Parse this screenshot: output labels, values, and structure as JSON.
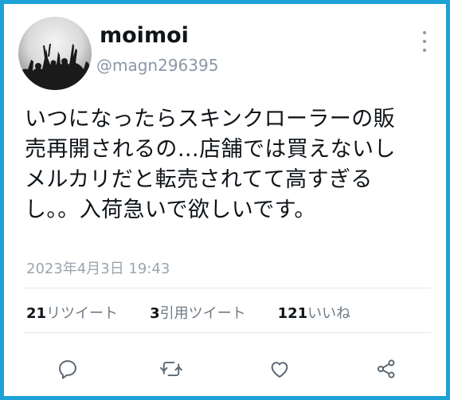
{
  "user": {
    "display_name": "moimoi",
    "handle": "@magn296395"
  },
  "tweet": {
    "text": "いつになったらスキンクローラーの販\n売再開されるの…店舗では買えないし\nメルカリだと転売されてて高すぎる\nし。。入荷急いで欲しいです。",
    "timestamp": "2023年4月3日 19:43"
  },
  "stats": {
    "retweets_count": "21",
    "retweets_label": "リツイート",
    "quotes_count": "3",
    "quotes_label": "引用ツイート",
    "likes_count": "121",
    "likes_label": "いいね"
  },
  "icons": {
    "more": "more-vertical-icon",
    "reply": "reply-icon",
    "retweet": "retweet-icon",
    "like": "heart-icon",
    "share": "share-icon"
  },
  "colors": {
    "frame_border": "#1da1d6",
    "text": "#0f1419",
    "muted": "#8b98a5",
    "icon": "#5b6773"
  }
}
